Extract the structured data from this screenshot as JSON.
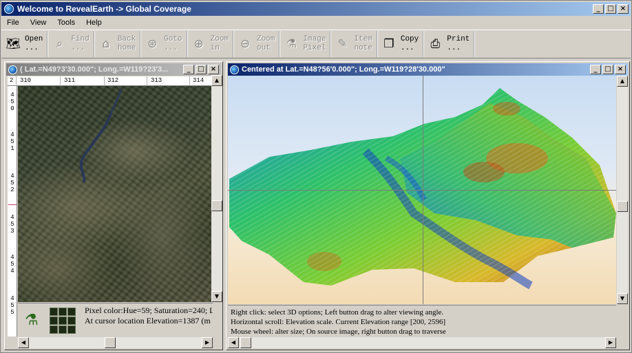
{
  "app": {
    "title": "Welcome to RevealEarth -> Global Coverage",
    "window_buttons": [
      "_",
      "□",
      "×"
    ]
  },
  "menu": [
    "File",
    "View",
    "Tools",
    "Help"
  ],
  "toolbar": [
    {
      "label": "Open\n...",
      "icon": "open-map-icon",
      "glyph": "🗺",
      "enabled": true
    },
    {
      "label": "Find\n...",
      "icon": "binoculars-icon",
      "glyph": "⌕",
      "enabled": false
    },
    {
      "label": "Back\nhome",
      "icon": "home-icon",
      "glyph": "⌂",
      "enabled": false
    },
    {
      "label": "Goto\n...",
      "icon": "compass-icon",
      "glyph": "⊛",
      "enabled": false
    },
    {
      "label": "Zoom\nin",
      "icon": "zoom-in-icon",
      "glyph": "⊕",
      "enabled": false
    },
    {
      "label": "Zoom\nout",
      "icon": "zoom-out-icon",
      "glyph": "⊖",
      "enabled": false
    },
    {
      "label": "Image\nPixel",
      "icon": "microscope-icon",
      "glyph": "⚗",
      "enabled": false
    },
    {
      "label": "Item\nnote",
      "icon": "note-icon",
      "glyph": "✎",
      "enabled": false
    },
    {
      "label": "Copy\n...",
      "icon": "copy-icon",
      "glyph": "❐",
      "enabled": true
    },
    {
      "label": "Print\n...",
      "icon": "printer-icon",
      "glyph": "⎙",
      "enabled": true
    }
  ],
  "left_window": {
    "title": "( Lat.=N49?3'30.000\"; Long.=W119?23'3...",
    "ruler_top": [
      "2",
      "310",
      "311",
      "312",
      "313",
      "314"
    ],
    "ruler_left": [
      "4\n5\n0",
      "4\n5\n1",
      "4\n5\n2",
      "4\n5\n3",
      "4\n5\n4",
      "4\n5\n5"
    ],
    "status": {
      "pixel_color": "Pixel color:Hue=59;  Saturation=240;  L",
      "elevation": "At cursor location Elevation=1387 (m"
    }
  },
  "right_window": {
    "title": "Centered at Lat.=N48?56'0.000\"; Long.=W119?28'30.000\"",
    "status": [
      "Right click: select 3D options; Left button drag to alter viewing angle.",
      "Horizontal scroll: Elevation scale. Current Elevation range [200, 2596]",
      "Mouse wheel: alter size; On source image, right button drag to traverse"
    ]
  }
}
